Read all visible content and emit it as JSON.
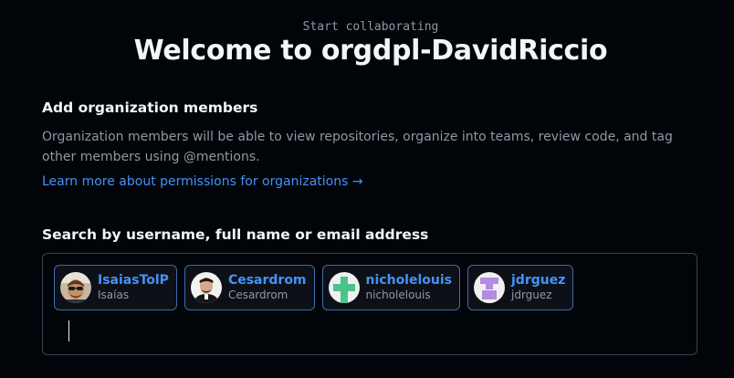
{
  "header": {
    "eyebrow": "Start collaborating",
    "title": "Welcome to orgdpl-DavidRiccio"
  },
  "members_section": {
    "heading": "Add organization members",
    "description": "Organization members will be able to view repositories, organize into teams, review code, and tag other members using @mentions.",
    "learn_more_link": "Learn more about permissions for organizations →"
  },
  "search": {
    "label": "Search by username, full name or email address",
    "input_value": "",
    "selected_users": [
      {
        "login": "IsaiasTolP",
        "name": "Isaías",
        "avatar": "photo-avatar-man-sunglasses"
      },
      {
        "login": "Cesardrom",
        "name": "Cesardrom",
        "avatar": "photo-avatar-man-dark"
      },
      {
        "login": "nicholelouis",
        "name": "nicholelouis",
        "avatar": "identicon-avatar-green",
        "avatar_color": "#4cc38a"
      },
      {
        "login": "jdrguez",
        "name": "jdrguez",
        "avatar": "identicon-avatar-purple",
        "avatar_color": "#b48be0"
      }
    ]
  },
  "colors": {
    "background": "#010409",
    "link": "#4493f8",
    "chip_border": "#3c6cac",
    "muted_text": "#9198a1",
    "input_border": "#3d444d"
  }
}
